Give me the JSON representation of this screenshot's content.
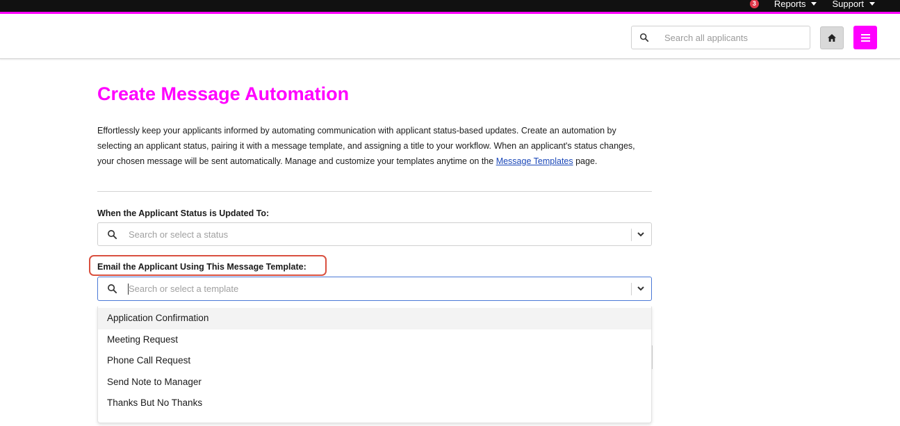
{
  "topbar": {
    "notification_count": "3",
    "reports_label": "Reports",
    "support_label": "Support"
  },
  "header": {
    "search_placeholder": "Search all applicants"
  },
  "page": {
    "title": "Create Message Automation",
    "intro_text": "Effortlessly keep your applicants informed by automating communication with applicant status-based updates. Create an automation by selecting an applicant status, pairing it with a message template, and assigning a title to your workflow. When an applicant's status changes, your chosen message will be sent automatically. Manage and customize your templates anytime on the ",
    "intro_link": "Message Templates",
    "intro_suffix": " page."
  },
  "form": {
    "status_label": "When the Applicant Status is Updated To:",
    "status_placeholder": "Search or select a status",
    "template_label": "Email the Applicant Using This Message Template:",
    "template_placeholder": "Search or select a template",
    "template_options": [
      "Application Confirmation",
      "Meeting Request",
      "Phone Call Request",
      "Send Note to Manager",
      "Thanks But No Thanks"
    ]
  },
  "colors": {
    "accent": "#ff00ff",
    "highlight": "#d9503f",
    "badge": "#e0384a",
    "link": "#1a47b8"
  },
  "icons": {
    "search": "search-icon",
    "home": "home-icon",
    "menu": "hamburger-menu-icon",
    "chevron": "chevron-down-icon"
  }
}
